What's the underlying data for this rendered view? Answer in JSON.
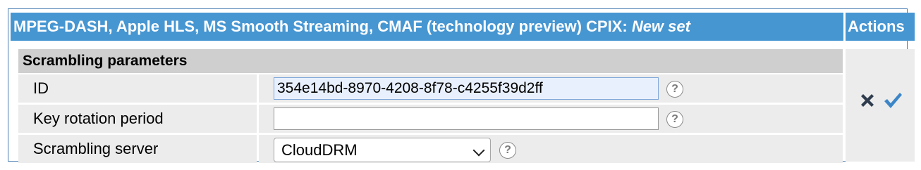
{
  "header": {
    "title_main": "MPEG-DASH, Apple HLS, MS Smooth Streaming, CMAF (technology preview) CPIX: ",
    "title_emphasis": "New set",
    "actions_label": "Actions"
  },
  "section": {
    "title": "Scrambling parameters"
  },
  "fields": {
    "id": {
      "label": "ID",
      "value": "354e14bd-8970-4208-8f78-c4255f39d2ff"
    },
    "key_rotation": {
      "label": "Key rotation period",
      "value": ""
    },
    "scrambling_server": {
      "label": "Scrambling server",
      "selected": "CloudDRM"
    }
  },
  "help_glyph": "?",
  "icons": {
    "cancel": "close-icon",
    "confirm": "check-icon",
    "help": "help-icon",
    "dropdown": "chevron-down-icon"
  },
  "colors": {
    "header_bg": "#4696d2",
    "section_bg": "#cfcfcf",
    "row_bg": "#ececec",
    "cancel_icon": "#2f3d4e",
    "confirm_icon": "#3c86c8"
  }
}
